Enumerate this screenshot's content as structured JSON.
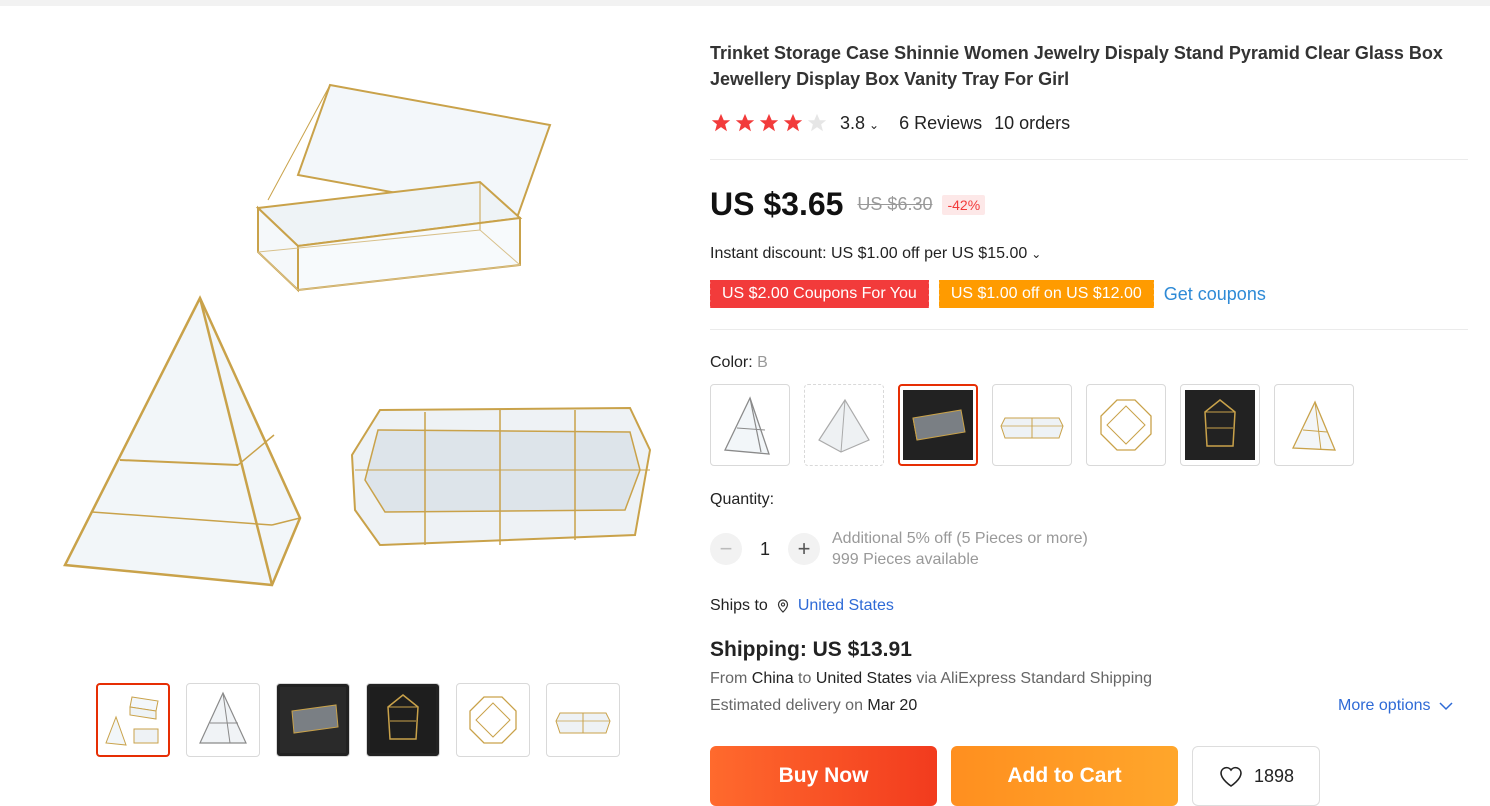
{
  "product": {
    "title": "Trinket Storage Case Shinnie Women Jewelry Dispaly Stand Pyramid Clear Glass Box Jewellery Display Box Vanity Tray For Girl",
    "rating": "3.8",
    "rating_stars": 4,
    "reviews": "6 Reviews",
    "orders": "10 orders"
  },
  "price": {
    "current": "US $3.65",
    "original": "US $6.30",
    "discount": "-42%"
  },
  "promo": {
    "instant_discount": "Instant discount: US $1.00 off per US $15.00",
    "coupon_red": "US $2.00 Coupons For You",
    "coupon_orange": "US $1.00 off on US $12.00",
    "get_coupons": "Get coupons"
  },
  "color": {
    "label": "Color: ",
    "selected": "B",
    "swatches": [
      "pyramid-gold",
      "pyramid-gray",
      "box-dark",
      "tray-clear",
      "octagon-clear",
      "geo-dark",
      "pyramid-gold-small"
    ],
    "selected_index": 2
  },
  "quantity": {
    "label": "Quantity:",
    "value": "1",
    "note1": "Additional 5% off (5 Pieces or more)",
    "note2": "999 Pieces available"
  },
  "shipping": {
    "ships_to_label": "Ships to",
    "ships_to": "United States",
    "title": "Shipping: US $13.91",
    "from_prefix": "From",
    "from": "China",
    "to_word": "to",
    "to": "United States",
    "via": "via AliExpress Standard Shipping",
    "est_prefix": "Estimated delivery on",
    "est_date": "Mar 20",
    "more_options": "More options"
  },
  "actions": {
    "buy_now": "Buy Now",
    "add_to_cart": "Add to Cart",
    "wishlist_count": "1898"
  },
  "gallery": {
    "thumbs": [
      "set",
      "pyramid",
      "box-dark",
      "geo-dark",
      "octagon",
      "tray"
    ],
    "active_index": 0
  },
  "colors": {
    "accent_red": "#e62e04",
    "link_blue": "#2e6ad6",
    "gold": "#c9a24a"
  }
}
